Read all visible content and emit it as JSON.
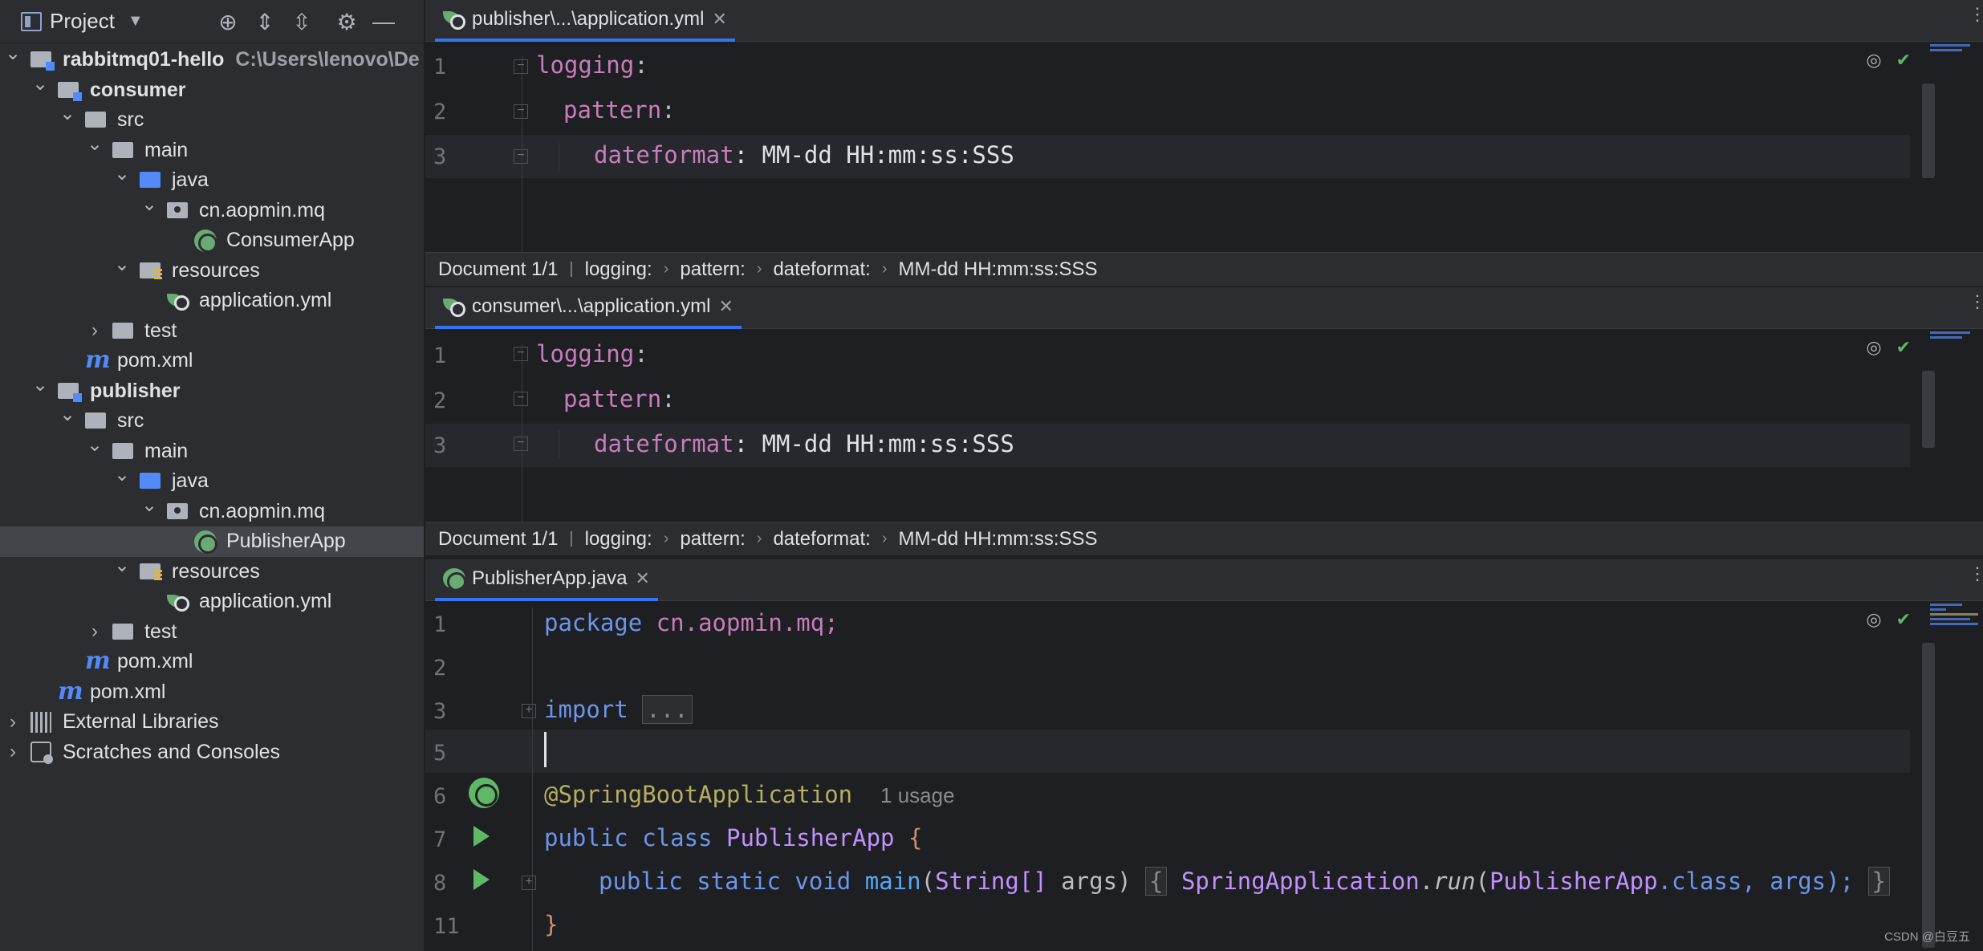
{
  "project_panel": {
    "title": "Project",
    "tree": [
      {
        "label": "rabbitmq01-hello",
        "path": "C:\\Users\\lenovo\\De",
        "depth": 0,
        "icon": "module-folder-icon",
        "expanded": true,
        "bold": true
      },
      {
        "label": "consumer",
        "depth": 1,
        "icon": "module-folder-icon",
        "expanded": true,
        "bold": true
      },
      {
        "label": "src",
        "depth": 2,
        "icon": "folder-icon",
        "expanded": true
      },
      {
        "label": "main",
        "depth": 3,
        "icon": "folder-icon",
        "expanded": true
      },
      {
        "label": "java",
        "depth": 4,
        "icon": "source-folder-icon",
        "expanded": true
      },
      {
        "label": "cn.aopmin.mq",
        "depth": 5,
        "icon": "package-icon",
        "expanded": true
      },
      {
        "label": "ConsumerApp",
        "depth": 6,
        "icon": "spring-boot-class-icon"
      },
      {
        "label": "resources",
        "depth": 4,
        "icon": "resources-folder-icon",
        "expanded": true
      },
      {
        "label": "application.yml",
        "depth": 5,
        "icon": "spring-yaml-icon"
      },
      {
        "label": "test",
        "depth": 3,
        "icon": "folder-icon",
        "expanded": false
      },
      {
        "label": "pom.xml",
        "depth": 2,
        "icon": "maven-icon"
      },
      {
        "label": "publisher",
        "depth": 1,
        "icon": "module-folder-icon",
        "expanded": true,
        "bold": true
      },
      {
        "label": "src",
        "depth": 2,
        "icon": "folder-icon",
        "expanded": true
      },
      {
        "label": "main",
        "depth": 3,
        "icon": "folder-icon",
        "expanded": true
      },
      {
        "label": "java",
        "depth": 4,
        "icon": "source-folder-icon",
        "expanded": true
      },
      {
        "label": "cn.aopmin.mq",
        "depth": 5,
        "icon": "package-icon",
        "expanded": true
      },
      {
        "label": "PublisherApp",
        "depth": 6,
        "icon": "spring-boot-class-icon",
        "selected": true
      },
      {
        "label": "resources",
        "depth": 4,
        "icon": "resources-folder-icon",
        "expanded": true
      },
      {
        "label": "application.yml",
        "depth": 5,
        "icon": "spring-yaml-icon"
      },
      {
        "label": "test",
        "depth": 3,
        "icon": "folder-icon",
        "expanded": false
      },
      {
        "label": "pom.xml",
        "depth": 2,
        "icon": "maven-icon"
      },
      {
        "label": "pom.xml",
        "depth": 1,
        "icon": "maven-icon"
      },
      {
        "label": "External Libraries",
        "depth": 0,
        "icon": "libraries-icon",
        "expanded": false
      },
      {
        "label": "Scratches and Consoles",
        "depth": 0,
        "icon": "scratches-icon",
        "expanded": false
      }
    ]
  },
  "editor1": {
    "tab": "publisher\\...\\application.yml",
    "lines": [
      {
        "n": "1",
        "key": "logging",
        "rest": ":"
      },
      {
        "n": "2",
        "key": "pattern",
        "rest": ":"
      },
      {
        "n": "3",
        "key": "dateformat",
        "rest": ": MM-dd HH:mm:ss:SSS"
      }
    ],
    "breadcrumb": [
      "Document 1/1",
      "logging:",
      "pattern:",
      "dateformat:",
      "MM-dd HH:mm:ss:SSS"
    ]
  },
  "editor2": {
    "tab": "consumer\\...\\application.yml",
    "lines": [
      {
        "n": "1",
        "key": "logging",
        "rest": ":"
      },
      {
        "n": "2",
        "key": "pattern",
        "rest": ":"
      },
      {
        "n": "3",
        "key": "dateformat",
        "rest": ": MM-dd HH:mm:ss:SSS"
      }
    ],
    "breadcrumb": [
      "Document 1/1",
      "logging:",
      "pattern:",
      "dateformat:",
      "MM-dd HH:mm:ss:SSS"
    ]
  },
  "editor3": {
    "tab": "PublisherApp.java",
    "line_numbers": [
      "1",
      "2",
      "3",
      "5",
      "6",
      "7",
      "8",
      "11"
    ],
    "package_kw": "package",
    "package_name": "cn.aopmin.mq;",
    "import_kw": "import",
    "import_fold": "...",
    "annotation": "@SpringBootApplication",
    "usage_hint": "1 usage",
    "class_kw": "public class",
    "class_name": "PublisherApp",
    "brace_open": "{",
    "method_kw": "public static void",
    "method_name": "main",
    "method_params_type": "String[]",
    "method_params_name": "args",
    "method_body_class": "SpringApplication",
    "method_body_call": "run",
    "method_body_arg": "PublisherApp",
    "method_body_rest": ".class, args);",
    "brace_close": "}"
  },
  "watermark": "CSDN @白豆五"
}
